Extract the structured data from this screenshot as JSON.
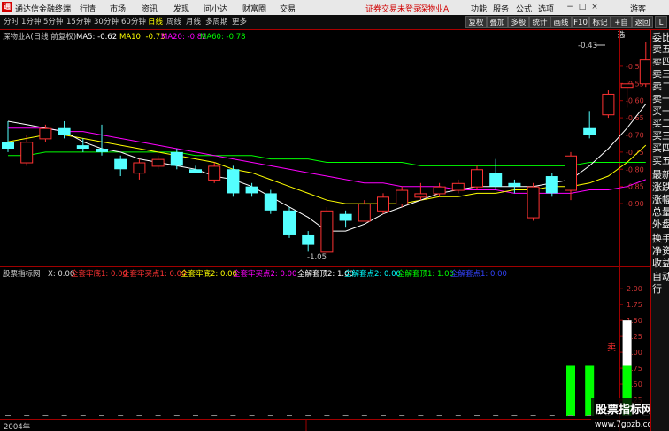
{
  "window": {
    "app_title": "通达信金融终端",
    "menu": [
      "行情",
      "市场",
      "资讯",
      "发现",
      "问小达",
      "财富圈",
      "交易"
    ],
    "status_text": "证券交易未登录",
    "stock_name": "深物业A",
    "right_menu": [
      "功能",
      "服务",
      "公式",
      "选项"
    ],
    "user": "游客",
    "buttons": [
      "−",
      "□",
      "×"
    ]
  },
  "toolbar": {
    "periods": [
      "分时",
      "1分钟",
      "5分钟",
      "15分钟",
      "30分钟",
      "60分钟",
      "日线",
      "周线",
      "月线",
      "多周期",
      "更多"
    ],
    "active_period": "日线",
    "right_buttons": [
      "复权",
      "叠加",
      "多股",
      "统计",
      "画线",
      "F10",
      "标记",
      "+自选",
      "返回"
    ]
  },
  "main_chart": {
    "title": "深物业A(日线 前复权)",
    "ma_labels": [
      {
        "text": "MA5: -0.62",
        "color": "#ffffff"
      },
      {
        "text": "MA10: -0.73",
        "color": "#ffff00"
      },
      {
        "text": "MA20: -0.82",
        "color": "#ff00ff"
      },
      {
        "text": "MA60: -0.78",
        "color": "#00ff00"
      }
    ],
    "price_ticks": [
      "-0.50",
      "-0.55",
      "-0.60",
      "-0.65",
      "-0.70",
      "-0.75",
      "-0.80",
      "-0.85",
      "-0.90"
    ],
    "high_label": "-0.43",
    "low_label": "-1.05"
  },
  "indicator": {
    "title": "股票指标网",
    "values": [
      {
        "text": "X: 0.00",
        "color": "#dddddd"
      },
      {
        "text": "全套牢底1: 0.00",
        "color": "#ff3333"
      },
      {
        "text": "全套牢买点1: 0.00",
        "color": "#ff3333"
      },
      {
        "text": "全套牢底2: 0.00",
        "color": "#ffff00"
      },
      {
        "text": "全套牢买点2: 0.00",
        "color": "#ff00ff"
      },
      {
        "text": "全解套顶2: 1.00",
        "color": "#ffffff"
      },
      {
        "text": "全解套点2: 0.00",
        "color": "#00ffff"
      },
      {
        "text": "全解套顶1: 1.00",
        "color": "#00ff00"
      },
      {
        "text": "全解套点1: 0.00",
        "color": "#3344ff"
      }
    ],
    "ticks": [
      "2.00",
      "1.75",
      "1.50",
      "1.25",
      "1.00",
      "0.75",
      "0.50",
      "0.25"
    ],
    "sell_label": "卖"
  },
  "bottom": {
    "year": "2004年",
    "watermark_cn": "股票指标网",
    "watermark_url": "www.7gpzb.com"
  },
  "right_panel": {
    "items": [
      "委比",
      "卖五",
      "卖四",
      "卖三",
      "卖二",
      "卖一",
      "买一",
      "买二",
      "买三",
      "买四",
      "买五",
      "最新",
      "涨跌",
      "涨幅",
      "总量",
      "外盘",
      "换手",
      "净资",
      "收益",
      "自动",
      "行"
    ]
  },
  "colors": {
    "up": "#ff3232",
    "down": "#54ffff",
    "ma5": "#ffffff",
    "ma10": "#ffff00",
    "ma20": "#ff00ff",
    "ma60": "#00ff00",
    "axis": "#a00000"
  },
  "chart_data": {
    "type": "candlestick",
    "y_range": [
      -1.07,
      -0.41
    ],
    "candles": [
      {
        "o": -0.72,
        "c": -0.74,
        "h": -0.66,
        "l": -0.75
      },
      {
        "o": -0.78,
        "c": -0.72,
        "h": -0.7,
        "l": -0.79
      },
      {
        "o": -0.71,
        "c": -0.68,
        "h": -0.67,
        "l": -0.72
      },
      {
        "o": -0.68,
        "c": -0.7,
        "h": -0.66,
        "l": -0.71
      },
      {
        "o": -0.73,
        "c": -0.74,
        "h": -0.71,
        "l": -0.75
      },
      {
        "o": -0.74,
        "c": -0.75,
        "h": -0.67,
        "l": -0.76
      },
      {
        "o": -0.77,
        "c": -0.8,
        "h": -0.76,
        "l": -0.82
      },
      {
        "o": -0.81,
        "c": -0.78,
        "h": -0.77,
        "l": -0.83
      },
      {
        "o": -0.79,
        "c": -0.77,
        "h": -0.76,
        "l": -0.8
      },
      {
        "o": -0.75,
        "c": -0.79,
        "h": -0.74,
        "l": -0.8
      },
      {
        "o": -0.8,
        "c": -0.81,
        "h": -0.79,
        "l": -0.81
      },
      {
        "o": -0.83,
        "c": -0.79,
        "h": -0.78,
        "l": -0.84
      },
      {
        "o": -0.8,
        "c": -0.87,
        "h": -0.79,
        "l": -0.88
      },
      {
        "o": -0.85,
        "c": -0.87,
        "h": -0.84,
        "l": -0.88
      },
      {
        "o": -0.87,
        "c": -0.92,
        "h": -0.86,
        "l": -0.93
      },
      {
        "o": -0.92,
        "c": -0.99,
        "h": -0.91,
        "l": -1.0
      },
      {
        "o": -0.99,
        "c": -1.02,
        "h": -0.98,
        "l": -1.04
      },
      {
        "o": -1.04,
        "c": -0.92,
        "h": -0.91,
        "l": -1.05
      },
      {
        "o": -0.93,
        "c": -0.95,
        "h": -0.92,
        "l": -0.97
      },
      {
        "o": -0.95,
        "c": -0.9,
        "h": -0.89,
        "l": -0.95
      },
      {
        "o": -0.92,
        "c": -0.88,
        "h": -0.87,
        "l": -0.93
      },
      {
        "o": -0.9,
        "c": -0.86,
        "h": -0.85,
        "l": -0.91
      },
      {
        "o": -0.88,
        "c": -0.87,
        "h": -0.84,
        "l": -0.89
      },
      {
        "o": -0.87,
        "c": -0.85,
        "h": -0.84,
        "l": -0.88
      },
      {
        "o": -0.86,
        "c": -0.84,
        "h": -0.83,
        "l": -0.87
      },
      {
        "o": -0.85,
        "c": -0.8,
        "h": -0.79,
        "l": -0.86
      },
      {
        "o": -0.81,
        "c": -0.85,
        "h": -0.77,
        "l": -0.86
      },
      {
        "o": -0.84,
        "c": -0.85,
        "h": -0.83,
        "l": -0.87
      },
      {
        "o": -0.94,
        "c": -0.85,
        "h": -0.84,
        "l": -0.95
      },
      {
        "o": -0.82,
        "c": -0.87,
        "h": -0.81,
        "l": -0.88
      },
      {
        "o": -0.86,
        "c": -0.76,
        "h": -0.75,
        "l": -0.89
      },
      {
        "o": -0.68,
        "c": -0.7,
        "h": -0.63,
        "l": -0.71
      },
      {
        "o": -0.64,
        "c": -0.58,
        "h": -0.57,
        "l": -0.65
      },
      {
        "o": -0.56,
        "c": -0.55,
        "h": -0.54,
        "l": -0.62
      },
      {
        "o": -0.55,
        "c": -0.48,
        "h": -0.43,
        "l": -0.56
      }
    ],
    "ma5": [
      -0.66,
      -0.67,
      -0.68,
      -0.69,
      -0.72,
      -0.74,
      -0.75,
      -0.77,
      -0.78,
      -0.79,
      -0.8,
      -0.82,
      -0.83,
      -0.85,
      -0.88,
      -0.91,
      -0.94,
      -0.98,
      -0.98,
      -0.96,
      -0.93,
      -0.91,
      -0.89,
      -0.87,
      -0.86,
      -0.85,
      -0.85,
      -0.85,
      -0.85,
      -0.84,
      -0.83,
      -0.79,
      -0.74,
      -0.68,
      -0.61
    ],
    "ma10": [
      -0.72,
      -0.71,
      -0.7,
      -0.7,
      -0.71,
      -0.72,
      -0.73,
      -0.74,
      -0.75,
      -0.76,
      -0.77,
      -0.78,
      -0.8,
      -0.81,
      -0.83,
      -0.85,
      -0.87,
      -0.89,
      -0.9,
      -0.9,
      -0.9,
      -0.9,
      -0.89,
      -0.88,
      -0.88,
      -0.87,
      -0.87,
      -0.86,
      -0.86,
      -0.85,
      -0.85,
      -0.84,
      -0.82,
      -0.78,
      -0.73
    ],
    "ma20": [
      -0.68,
      -0.68,
      -0.68,
      -0.69,
      -0.69,
      -0.7,
      -0.71,
      -0.72,
      -0.73,
      -0.74,
      -0.75,
      -0.76,
      -0.77,
      -0.78,
      -0.79,
      -0.8,
      -0.81,
      -0.82,
      -0.83,
      -0.84,
      -0.84,
      -0.85,
      -0.85,
      -0.85,
      -0.86,
      -0.86,
      -0.86,
      -0.87,
      -0.87,
      -0.87,
      -0.87,
      -0.86,
      -0.86,
      -0.85,
      -0.83
    ],
    "ma60": [
      -0.76,
      -0.76,
      -0.75,
      -0.75,
      -0.75,
      -0.75,
      -0.75,
      -0.75,
      -0.75,
      -0.75,
      -0.76,
      -0.76,
      -0.76,
      -0.76,
      -0.77,
      -0.77,
      -0.77,
      -0.78,
      -0.78,
      -0.78,
      -0.78,
      -0.78,
      -0.79,
      -0.79,
      -0.79,
      -0.79,
      -0.79,
      -0.79,
      -0.79,
      -0.79,
      -0.79,
      -0.78,
      -0.78,
      -0.78,
      -0.78
    ],
    "indicator_range": [
      0,
      2.1
    ],
    "indicator_bars": [
      {
        "index": 30,
        "value": 0.8,
        "color": "#00ff00"
      },
      {
        "index": 31,
        "value": 0.8,
        "color": "#00ff00"
      },
      {
        "index": 33,
        "value": 1.5,
        "color": "#ffffff",
        "lower": 0.8,
        "lower_color": "#00ff00"
      }
    ]
  }
}
